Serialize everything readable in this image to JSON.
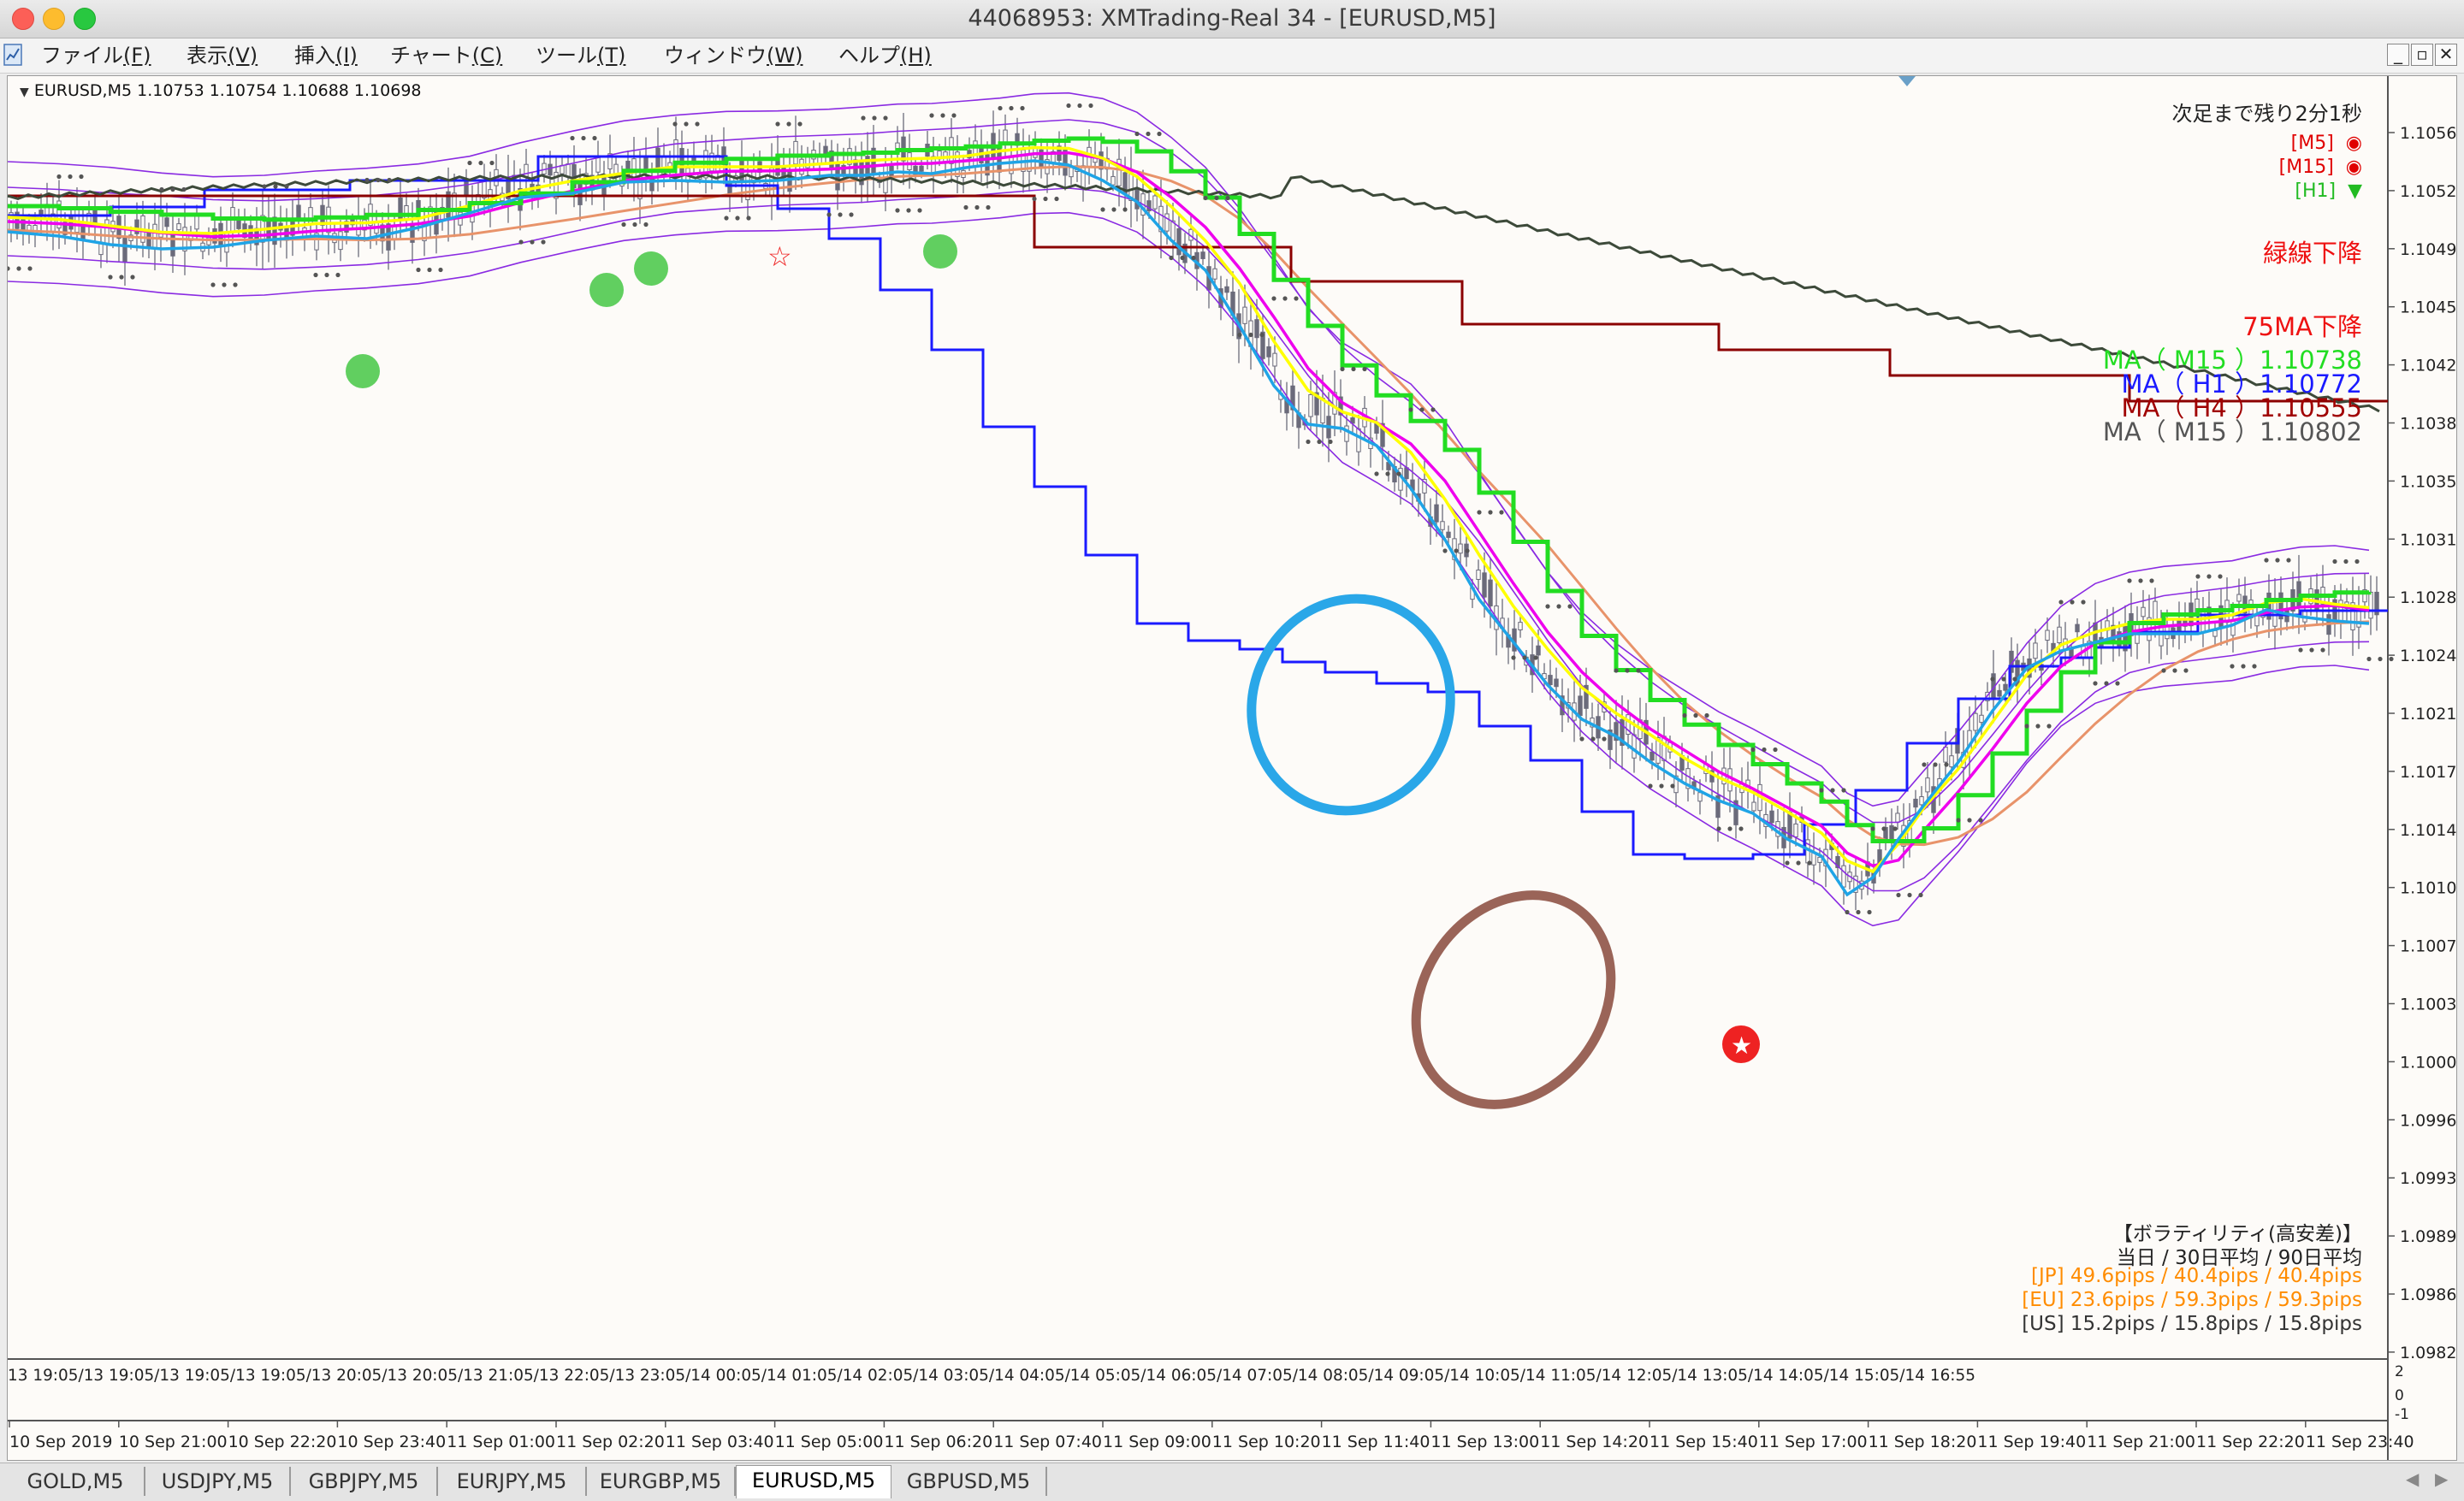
{
  "window": {
    "title": "44068953: XMTrading-Real 34 - [EURUSD,M5]"
  },
  "menu": [
    {
      "label": "ファイル",
      "accel": "(F)"
    },
    {
      "label": "表示",
      "accel": "(V)"
    },
    {
      "label": "挿入",
      "accel": "(I)"
    },
    {
      "label": "チャート",
      "accel": "(C)"
    },
    {
      "label": "ツール",
      "accel": "(T)"
    },
    {
      "label": "ウィンドウ",
      "accel": "(W)"
    },
    {
      "label": "ヘルプ",
      "accel": "(H)"
    }
  ],
  "window_controls": [
    "_",
    "▫",
    "✕"
  ],
  "chart": {
    "symbol_line": "EURUSD,M5  1.10753 1.10754 1.10688 1.10698",
    "countdown": "次足まで残り2分1秒",
    "timeframe_signals": [
      {
        "label": "[M5]",
        "color": "#e00000",
        "icon": "red-bull-icon"
      },
      {
        "label": "[M15]",
        "color": "#e00000",
        "icon": "red-bull-icon"
      },
      {
        "label": "[H1]",
        "color": "#22bb22",
        "icon": "green-triangle-icon"
      }
    ],
    "trend_text_1": "緑線下降",
    "trend_text_2": "75MA下降",
    "ma_readouts": [
      {
        "text": "MA（ M15 ）1.10738",
        "color": "#22dd22"
      },
      {
        "text": "MA（ H1 ）1.10772",
        "color": "#1a1aff"
      },
      {
        "text": "MA（ H4 ）1.10555",
        "color": "#a00000"
      },
      {
        "text": "MA（ M15 ）1.10802",
        "color": "#555555"
      }
    ],
    "volatility": {
      "title": "【ボラティリティ(高安差)】",
      "subtitle": "当日 / 30日平均 / 90日平均",
      "rows": [
        {
          "text": "[JP] 49.6pips / 40.4pips / 40.4pips",
          "color": "#ff8c00"
        },
        {
          "text": "[EU] 23.6pips / 59.3pips / 59.3pips",
          "color": "#ff8c00"
        },
        {
          "text": "[US] 15.2pips / 15.8pips / 15.8pips",
          "color": "#333333"
        }
      ]
    },
    "price_ticks": [
      "1.10560",
      "1.10525",
      "1.10490",
      "1.10455",
      "1.10420",
      "1.10385",
      "1.10350",
      "1.10315",
      "1.10280",
      "1.10245",
      "1.10210",
      "1.10175",
      "1.10140",
      "1.10105",
      "1.10070",
      "1.10035",
      "1.10000",
      "1.09965",
      "1.09930",
      "1.09895",
      "1.09860",
      "1.09825"
    ],
    "session_time_labels": "13 19:05/13 19:05/13 19:05/13 19:05/13 20:05/13 20:05/13 21:05/13 22:05/13 23:05/14 00:05/14 01:05/14 02:05/14 03:05/14 04:05/14 05:05/14 06:05/14 07:05/14 08:05/14 09:05/14 10:05/14 11:05/14 12:05/14 13:05/14 14:05/14 15:05/14 16:55",
    "sub_panel_ticks": [
      "2",
      "0",
      "-1"
    ],
    "time_ticks": [
      "10 Sep 2019",
      "10 Sep 21:00",
      "10 Sep 22:20",
      "10 Sep 23:40",
      "11 Sep 01:00",
      "11 Sep 02:20",
      "11 Sep 03:40",
      "11 Sep 05:00",
      "11 Sep 06:20",
      "11 Sep 07:40",
      "11 Sep 09:00",
      "11 Sep 10:20",
      "11 Sep 11:40",
      "11 Sep 13:00",
      "11 Sep 14:20",
      "11 Sep 15:40",
      "11 Sep 17:00",
      "11 Sep 18:20",
      "11 Sep 19:40",
      "11 Sep 21:00",
      "11 Sep 22:20",
      "11 Sep 23:40"
    ]
  },
  "tabs": [
    {
      "label": "GOLD,M5",
      "active": false
    },
    {
      "label": "USDJPY,M5",
      "active": false
    },
    {
      "label": "GBPJPY,M5",
      "active": false
    },
    {
      "label": "EURJPY,M5",
      "active": false
    },
    {
      "label": "EURGBP,M5",
      "active": false
    },
    {
      "label": "EURUSD,M5",
      "active": true
    },
    {
      "label": "GBPUSD,M5",
      "active": false
    }
  ],
  "colors": {
    "bg": "#fdfbf8",
    "candle": "#6b6b7b",
    "bb": "#8a2be2",
    "ma_green": "#22dd22",
    "ma_yellow": "#ffff00",
    "ma_magenta": "#ee00ee",
    "ma_cyan": "#1fa4e6",
    "ma_h1": "#1a1aff",
    "ma_h4": "#8b0000",
    "ma_long": "#3d4a3a",
    "ma_orange": "#e8936a",
    "circle_blue": "#2aa7e8",
    "circle_brown": "#9a6458"
  }
}
